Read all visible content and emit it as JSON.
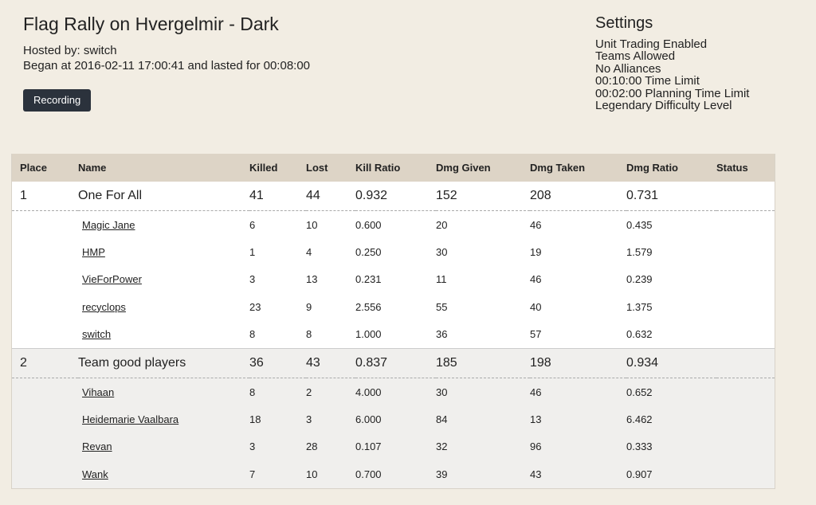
{
  "game": {
    "title": "Flag Rally on Hvergelmir - Dark",
    "hosted_by": "Hosted by: switch",
    "began": "Began at 2016-02-11 17:00:41 and lasted for 00:08:00",
    "recording_label": "Recording"
  },
  "settings": {
    "title": "Settings",
    "items": [
      "Unit Trading Enabled",
      "Teams Allowed",
      "No Alliances",
      "00:10:00 Time Limit",
      "00:02:00 Planning Time Limit",
      "Legendary Difficulty Level"
    ]
  },
  "table": {
    "headers": [
      "Place",
      "Name",
      "Killed",
      "Lost",
      "Kill Ratio",
      "Dmg Given",
      "Dmg Taken",
      "Dmg Ratio",
      "Status"
    ],
    "teams": [
      {
        "place": "1",
        "name": "One For All",
        "killed": "41",
        "lost": "44",
        "kill_ratio": "0.932",
        "dmg_given": "152",
        "dmg_taken": "208",
        "dmg_ratio": "0.731",
        "status": "",
        "players": [
          {
            "name": "Magic Jane",
            "killed": "6",
            "lost": "10",
            "kill_ratio": "0.600",
            "dmg_given": "20",
            "dmg_taken": "46",
            "dmg_ratio": "0.435"
          },
          {
            "name": "HMP",
            "killed": "1",
            "lost": "4",
            "kill_ratio": "0.250",
            "dmg_given": "30",
            "dmg_taken": "19",
            "dmg_ratio": "1.579"
          },
          {
            "name": "VieForPower",
            "killed": "3",
            "lost": "13",
            "kill_ratio": "0.231",
            "dmg_given": "11",
            "dmg_taken": "46",
            "dmg_ratio": "0.239"
          },
          {
            "name": "recyclops",
            "killed": "23",
            "lost": "9",
            "kill_ratio": "2.556",
            "dmg_given": "55",
            "dmg_taken": "40",
            "dmg_ratio": "1.375"
          },
          {
            "name": "switch",
            "killed": "8",
            "lost": "8",
            "kill_ratio": "1.000",
            "dmg_given": "36",
            "dmg_taken": "57",
            "dmg_ratio": "0.632"
          }
        ]
      },
      {
        "place": "2",
        "name": "Team good players",
        "killed": "36",
        "lost": "43",
        "kill_ratio": "0.837",
        "dmg_given": "185",
        "dmg_taken": "198",
        "dmg_ratio": "0.934",
        "status": "",
        "players": [
          {
            "name": "Vihaan",
            "killed": "8",
            "lost": "2",
            "kill_ratio": "4.000",
            "dmg_given": "30",
            "dmg_taken": "46",
            "dmg_ratio": "0.652"
          },
          {
            "name": "Heidemarie Vaalbara",
            "killed": "18",
            "lost": "3",
            "kill_ratio": "6.000",
            "dmg_given": "84",
            "dmg_taken": "13",
            "dmg_ratio": "6.462"
          },
          {
            "name": "Revan",
            "killed": "3",
            "lost": "28",
            "kill_ratio": "0.107",
            "dmg_given": "32",
            "dmg_taken": "96",
            "dmg_ratio": "0.333"
          },
          {
            "name": "Wank",
            "killed": "7",
            "lost": "10",
            "kill_ratio": "0.700",
            "dmg_given": "39",
            "dmg_taken": "43",
            "dmg_ratio": "0.907"
          }
        ]
      }
    ]
  }
}
